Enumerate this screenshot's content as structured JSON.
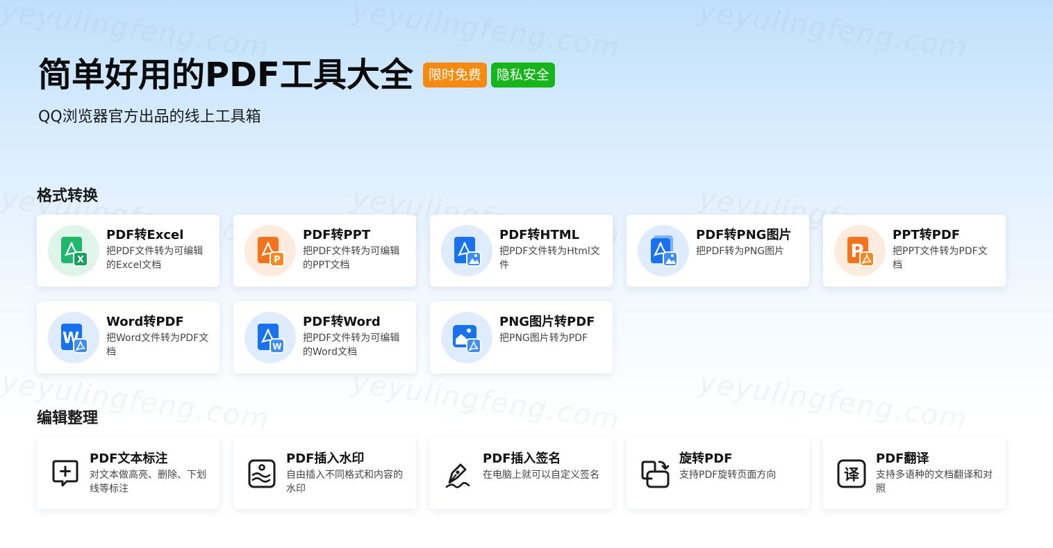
{
  "hero": {
    "title": "简单好用的PDF工具大全",
    "badge_free": "限时免费",
    "badge_privacy": "隐私安全",
    "subtitle": "QQ浏览器官方出品的线上工具箱"
  },
  "watermark_text": "yeyulingfeng.com",
  "sections": {
    "convert": {
      "title": "格式转换",
      "cards": [
        {
          "title": "PDF转Excel",
          "desc": "把PDF文件转为可编辑的Excel文档",
          "icon": "pdf-to-excel-icon"
        },
        {
          "title": "PDF转PPT",
          "desc": "把PDF文件转为可编辑的PPT文档",
          "icon": "pdf-to-ppt-icon"
        },
        {
          "title": "PDF转HTML",
          "desc": "把PDF文件转为Html文件",
          "icon": "pdf-to-html-icon"
        },
        {
          "title": "PDF转PNG图片",
          "desc": "把PDF转为PNG图片",
          "icon": "pdf-to-png-icon"
        },
        {
          "title": "PPT转PDF",
          "desc": "把PPT文件转为PDF文档",
          "icon": "ppt-to-pdf-icon"
        },
        {
          "title": "Word转PDF",
          "desc": "把Word文件转为PDF文档",
          "icon": "word-to-pdf-icon"
        },
        {
          "title": "PDF转Word",
          "desc": "把PDF文件转为可编辑的Word文档",
          "icon": "pdf-to-word-icon"
        },
        {
          "title": "PNG图片转PDF",
          "desc": "把PNG图片转为PDF",
          "icon": "png-to-pdf-icon"
        }
      ]
    },
    "edit": {
      "title": "编辑整理",
      "cards": [
        {
          "title": "PDF文本标注",
          "desc": "对文本做高亮、删除、下划线等标注",
          "icon": "annotate-icon"
        },
        {
          "title": "PDF插入水印",
          "desc": "自由插入不同格式和内容的水印",
          "icon": "watermark-icon"
        },
        {
          "title": "PDF插入签名",
          "desc": "在电脑上就可以自定义签名",
          "icon": "signature-icon"
        },
        {
          "title": "旋转PDF",
          "desc": "支持PDF旋转页面方向",
          "icon": "rotate-icon"
        },
        {
          "title": "PDF翻译",
          "desc": "支持多语种的文档翻译和对照",
          "icon": "translate-icon"
        }
      ]
    }
  },
  "colors": {
    "excel_green": "#1fb86a",
    "ppt_orange": "#f5731b",
    "pdf_blue": "#1772f0",
    "badge_orange": "#f78a0f",
    "badge_green": "#16b51c"
  }
}
